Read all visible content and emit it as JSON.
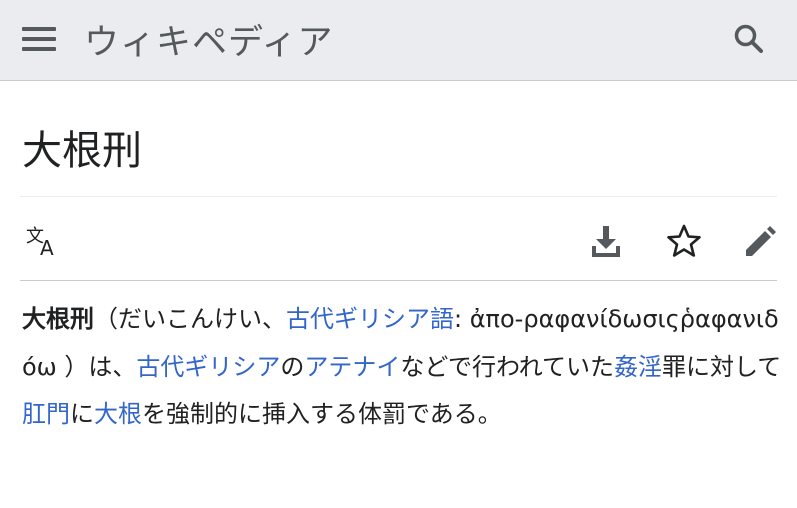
{
  "header": {
    "site_name": "ウィキペディア",
    "menu_icon": "hamburger-menu-icon",
    "search_icon": "search-icon"
  },
  "page": {
    "title": "大根刑"
  },
  "toolbar": {
    "language_icon": "language-icon",
    "download_icon": "download-icon",
    "watch_icon": "star-icon",
    "edit_icon": "pencil-icon"
  },
  "content": {
    "bold_term": "大根刑",
    "text_1": "（だいこんけい、",
    "link_ancient_greek_language": "古代ギリシア語",
    "text_2": ": ",
    "greek_term": "ἀπο-ραφανίδωσιςῥαφανιδόω",
    "text_3": " ）は、",
    "link_ancient_greece": "古代ギリシア",
    "text_4": "の",
    "link_athens": "アテナイ",
    "text_5": "などで行われていた",
    "link_adultery": "姦淫",
    "text_6": "罪に対して",
    "link_anus": "肛門",
    "text_7": "に",
    "link_daikon": "大根",
    "text_8": "を強制的に挿入する体罰である。"
  },
  "colors": {
    "header_bg": "#eaecf0",
    "link": "#3366cc",
    "text": "#202122",
    "icon": "#54595d"
  }
}
